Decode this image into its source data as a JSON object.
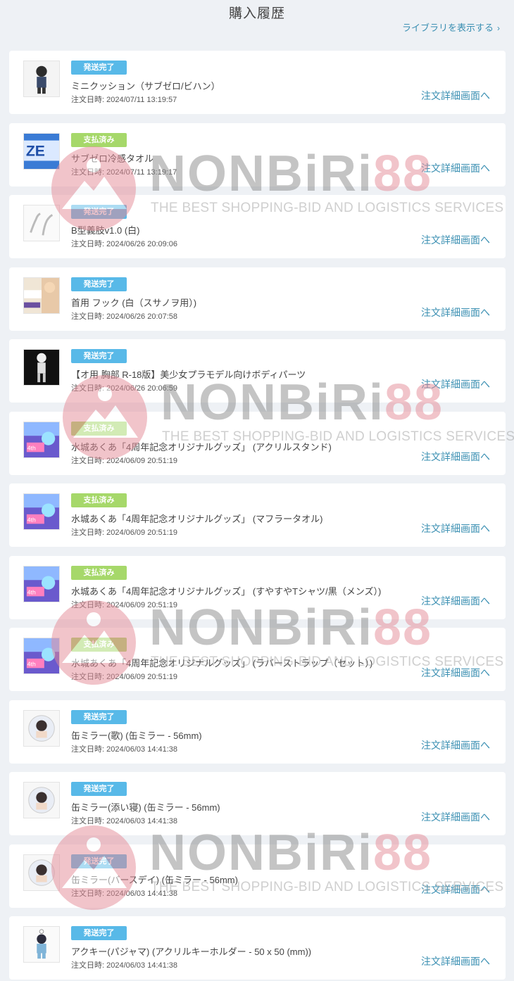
{
  "header": {
    "title": "購入履歴",
    "library_link": "ライブラリを表示する",
    "library_chevron": "›"
  },
  "colors": {
    "shipped_badge": "#58b9e8",
    "paid_badge": "#a6d86a",
    "link": "#3a8fb2",
    "background": "#eef1f5"
  },
  "orders": [
    {
      "status": "発送完了",
      "status_type": "shipped",
      "name": "ミニクッション（サブゼロ/ビハン）",
      "date": "注文日時: 2024/07/11 13:19:57",
      "detail": "注文詳細画面へ",
      "thumb_icon": "figure-icon"
    },
    {
      "status": "支払済み",
      "status_type": "paid",
      "name": "サブゼロ冷感タオル",
      "date": "注文日時: 2024/07/11 13:19:17",
      "detail": "注文詳細画面へ",
      "thumb_icon": "towel-banner-icon"
    },
    {
      "status": "発送完了",
      "status_type": "shipped",
      "name": "B型義肢v1.0 (白)",
      "date": "注文日時: 2024/06/26 20:09:06",
      "detail": "注文詳細画面へ",
      "thumb_icon": "limb-sketch-icon"
    },
    {
      "status": "発送完了",
      "status_type": "shipped",
      "name": "首用 フック (白（スサノヲ用）)",
      "date": "注文日時: 2024/06/26 20:07:58",
      "detail": "注文詳細画面へ",
      "thumb_icon": "neck-hook-icon"
    },
    {
      "status": "発送完了",
      "status_type": "shipped",
      "name": "【オ用 胸部 R-18版】美少女プラモデル向けボディパーツ",
      "date": "注文日時: 2024/06/26 20:06:59",
      "detail": "注文詳細画面へ",
      "thumb_icon": "model-figure-icon"
    },
    {
      "status": "支払済み",
      "status_type": "paid",
      "name": "水城あくあ「4周年記念オリジナルグッズ」 (アクリルスタンド)",
      "date": "注文日時: 2024/06/09 20:51:19",
      "detail": "注文詳細画面へ",
      "thumb_icon": "anniversary-goods-icon"
    },
    {
      "status": "支払済み",
      "status_type": "paid",
      "name": "水城あくあ「4周年記念オリジナルグッズ」 (マフラータオル)",
      "date": "注文日時: 2024/06/09 20:51:19",
      "detail": "注文詳細画面へ",
      "thumb_icon": "anniversary-goods-icon"
    },
    {
      "status": "支払済み",
      "status_type": "paid",
      "name": "水城あくあ「4周年記念オリジナルグッズ」 (すやすやTシャツ/黒（メンズ）)",
      "date": "注文日時: 2024/06/09 20:51:19",
      "detail": "注文詳細画面へ",
      "thumb_icon": "anniversary-goods-icon"
    },
    {
      "status": "支払済み",
      "status_type": "paid",
      "name": "水城あくあ「4周年記念オリジナルグッズ」 (ラバーストラップ（セット）)",
      "date": "注文日時: 2024/06/09 20:51:19",
      "detail": "注文詳細画面へ",
      "thumb_icon": "anniversary-goods-icon"
    },
    {
      "status": "発送完了",
      "status_type": "shipped",
      "name": "缶ミラー(歌) (缶ミラー - 56mm)",
      "date": "注文日時: 2024/06/03 14:41:38",
      "detail": "注文詳細画面へ",
      "thumb_icon": "can-mirror-icon"
    },
    {
      "status": "発送完了",
      "status_type": "shipped",
      "name": "缶ミラー(添い寝) (缶ミラー - 56mm)",
      "date": "注文日時: 2024/06/03 14:41:38",
      "detail": "注文詳細画面へ",
      "thumb_icon": "can-mirror-icon"
    },
    {
      "status": "発送完了",
      "status_type": "shipped",
      "name": "缶ミラー(バースデイ) (缶ミラー - 56mm)",
      "date": "注文日時: 2024/06/03 14:41:38",
      "detail": "注文詳細画面へ",
      "thumb_icon": "can-mirror-icon"
    },
    {
      "status": "発送完了",
      "status_type": "shipped",
      "name": "アクキー(パジャマ) (アクリルキーホルダー - 50 x 50 (mm))",
      "date": "注文日時: 2024/06/03 14:41:38",
      "detail": "注文詳細画面へ",
      "thumb_icon": "keychain-figure-icon"
    }
  ],
  "watermark": {
    "main_prefix": "NONBiRi",
    "main_suffix": "88",
    "sub": "THE BEST SHOPPING-BID AND LOGISTICS SERVICES"
  }
}
